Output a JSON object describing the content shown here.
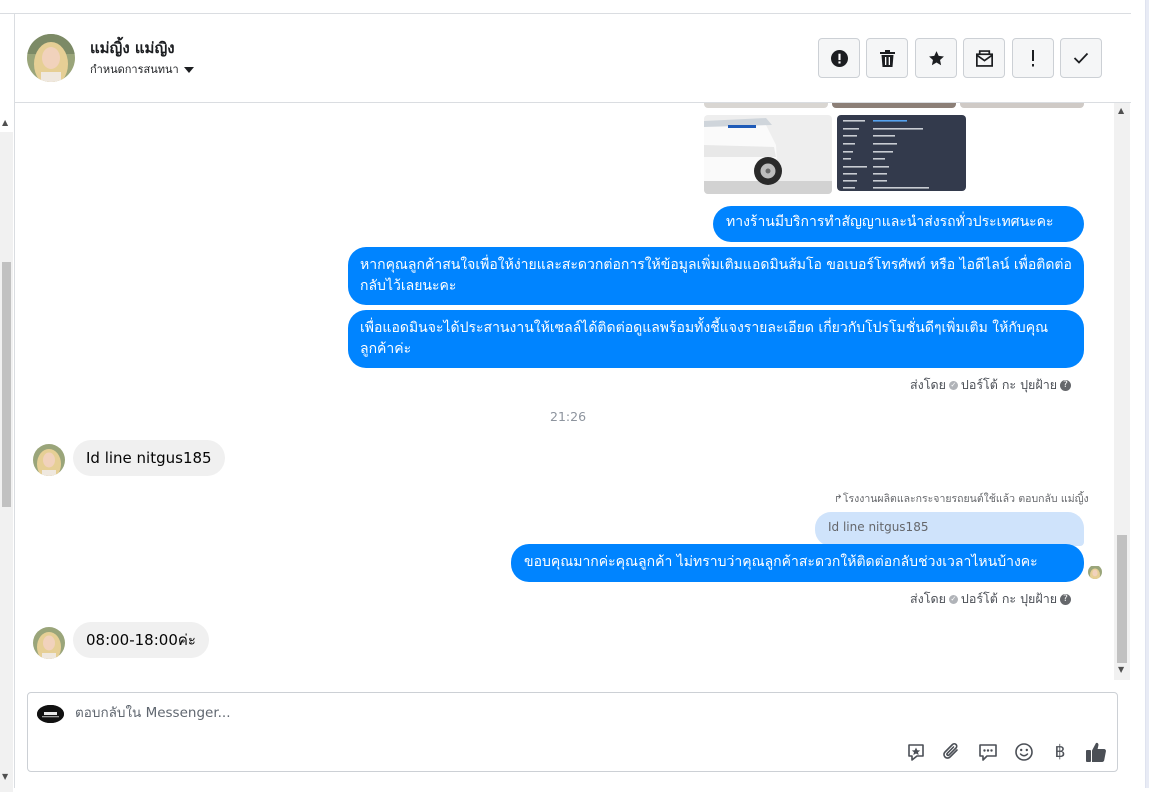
{
  "header": {
    "contact_name": "แม่ญิ้ง แม่ญิง",
    "conversation_menu_label": "กำหนดการสนทนา"
  },
  "toolbar": {
    "buttons": [
      {
        "name": "spam",
        "icon": "alert-circle-icon"
      },
      {
        "name": "delete",
        "icon": "trash-icon"
      },
      {
        "name": "star",
        "icon": "star-icon"
      },
      {
        "name": "mark-unread",
        "icon": "envelope-icon"
      },
      {
        "name": "important",
        "icon": "exclamation-icon"
      },
      {
        "name": "done",
        "icon": "check-icon"
      }
    ]
  },
  "messages": {
    "out_1": "ทางร้านมีบริการทำสัญญาและนำส่งรถทั่วประเทศนะคะ",
    "out_2": "หากคุณลูกค้าสนใจเพื่อให้ง่ายและสะดวกต่อการให้ข้อมูลเพิ่มเติมแอดมินส้มโอ ขอเบอร์โทรศัพท์ หรือ ไอดีไลน์ เพื่อติดต่อกลับไว้เลยนะคะ",
    "out_3": "เพื่อแอดมินจะได้ประสานงานให้เซลล์ได้ติดต่อดูแลพร้อมทั้งชี้แจงรายละเอียด เกี่ยวกับโปรโมชั่นดีๆเพิ่มเติม ให้กับคุณลูกค้าค่ะ",
    "sent_by_label": "ส่งโดย",
    "sent_by_name": "ปอร์โต้ กะ ปุยฝ้าย",
    "timestamp": "21:26",
    "in_1": "Id line nitgus185",
    "reply_note": "โรงงานผลิตและกระจายรถยนต์ใช้แล้ว ตอบกลับ แม่ญิ้ง",
    "quoted_text": "Id line nitgus185",
    "out_4": "ขอบคุณมากค่ะคุณลูกค้า ไม่ทราบว่าคุณลูกค้าสะดวกให้ติดต่อกลับช่วงเวลาไหนบ้างคะ",
    "in_2": "08:00-18:00ค่ะ"
  },
  "composer": {
    "placeholder": "ตอบกลับใน Messenger...",
    "icons": [
      "sticker-icon",
      "attachment-icon",
      "saved-reply-icon",
      "emoji-icon",
      "payment-icon",
      "like-icon"
    ]
  },
  "colors": {
    "outgoing_bubble": "#0084ff",
    "incoming_bubble": "#f0f0f0",
    "quoted_bubble": "#cfe3fb",
    "like_icon": "#4b4f56"
  }
}
